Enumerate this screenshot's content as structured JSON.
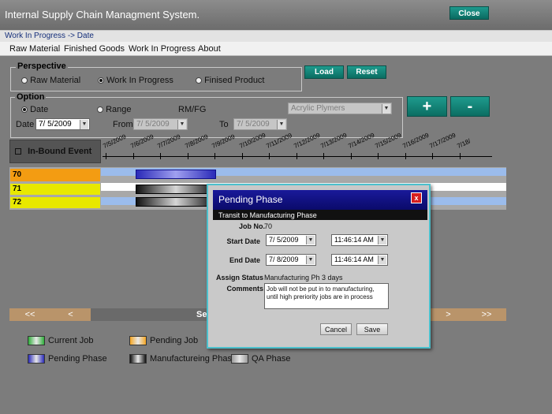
{
  "header": {
    "title": "Internal Supply Chain Managment System.",
    "close_label": "Close"
  },
  "breadcrumb": "Work In Progress -> Date",
  "menu": [
    "Raw Material",
    "Finished Goods",
    "Work In Progress",
    "About"
  ],
  "perspective": {
    "label": "Perspective",
    "options": [
      "Raw Material",
      "Work In Progress",
      "Finised Product"
    ],
    "selected": "Work In Progress"
  },
  "actions": {
    "load": "Load",
    "reset": "Reset",
    "zoom_in": "+",
    "zoom_out": "-"
  },
  "option": {
    "label": "Option",
    "date_radio": "Date",
    "range_radio": "Range",
    "selected": "Date",
    "rmfg_label": "RM/FG",
    "material_select": "Acrylic Plymers",
    "date_label": "Date",
    "date_value": "7/ 5/2009",
    "from_label": "From",
    "from_value": "7/ 5/2009",
    "to_label": "To",
    "to_value": "7/ 5/2009"
  },
  "timeline": {
    "inbound_label": "In-Bound Event",
    "dates": [
      "7/5/2009",
      "7/6/2009",
      "7/7/2009",
      "7/8/2009",
      "7/9/2009",
      "7/10/2009",
      "7/11/2009",
      "7/12/2009",
      "7/13/2009",
      "7/14/2009",
      "7/15/2009",
      "7/16/2009",
      "7/17/2009",
      "7/18/"
    ],
    "jobs": [
      {
        "id": "70",
        "color": "#f39c12"
      },
      {
        "id": "71",
        "color": "#e8e800"
      },
      {
        "id": "72",
        "color": "#e8e800"
      }
    ]
  },
  "nav": {
    "first": "<<",
    "prev": "<",
    "center": "Se",
    "next": ">",
    "last": ">>"
  },
  "legend": [
    {
      "label": "Current Job",
      "color": "#2fae3a"
    },
    {
      "label": "Pending Job",
      "color": "#f5a623"
    },
    {
      "label": "Pending Phase",
      "color": "#2a2ab8"
    },
    {
      "label": "Manufactureing Phase",
      "color": "#111111"
    },
    {
      "label": "QA Phase",
      "color": "#9a9a9a"
    }
  ],
  "dialog": {
    "title": "Pending Phase",
    "close": "x",
    "subtitle": "Transit to Manufacturing Phase",
    "job_label": "Job No.",
    "job_value": "70",
    "start_label": "Start Date",
    "start_date": "7/ 5/2009",
    "start_time": "11:46:14 AM",
    "end_label": "End Date",
    "end_date": "7/ 8/2009",
    "end_time": "11:46:14 AM",
    "status_label": "Assign Status",
    "status_value": "Manufacturing Ph 3 days",
    "comments_label": "Comments",
    "comments_value": "Job will not be put in to manufacturing, until high preriority jobs are in process",
    "cancel": "Cancel",
    "save": "Save"
  }
}
